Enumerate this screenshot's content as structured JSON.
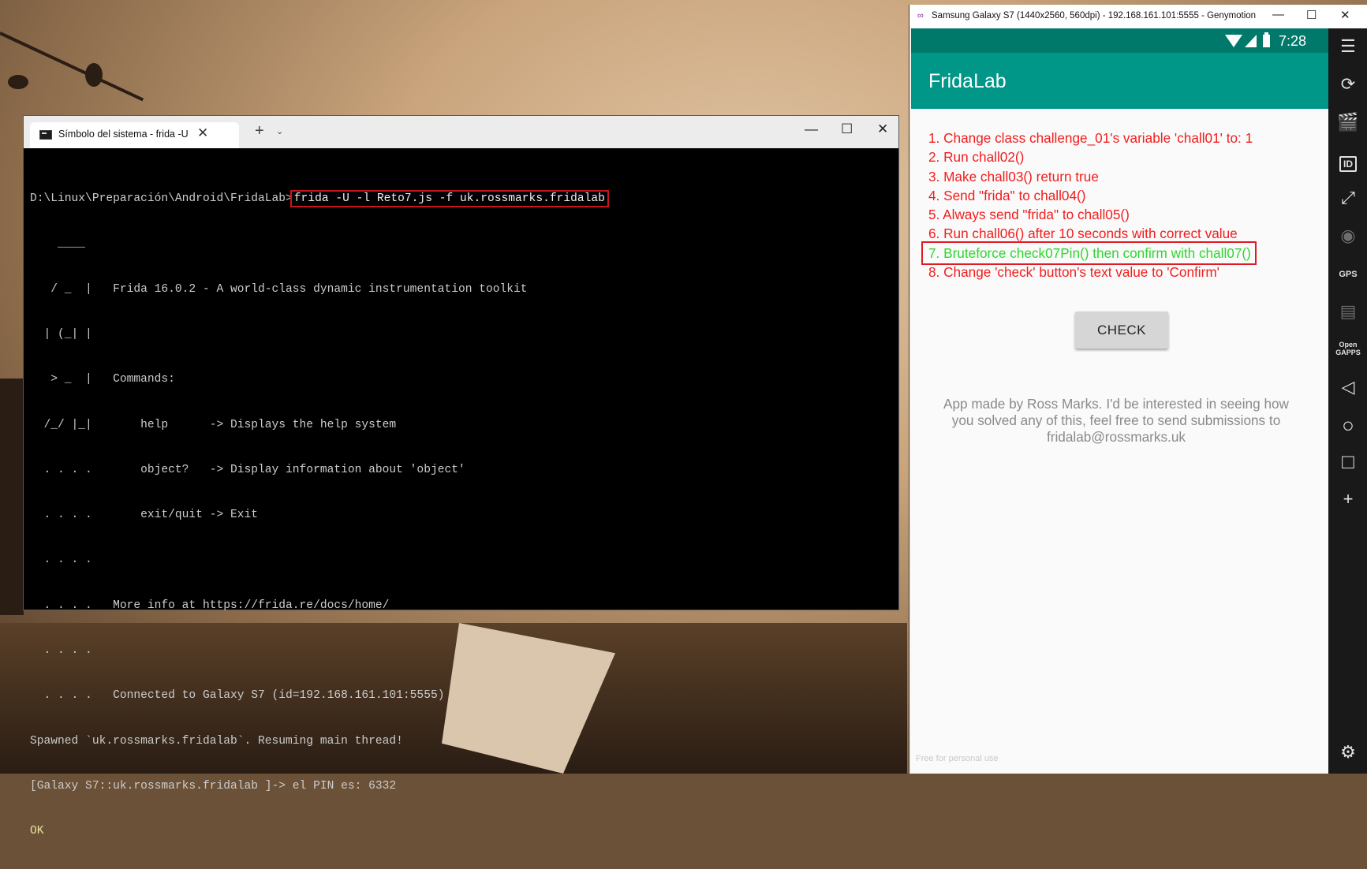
{
  "terminal": {
    "tab_title": "Símbolo del sistema - frida  -U",
    "tab_close": "✕",
    "new_tab": "+",
    "dropdown": "⌄",
    "minimize": "—",
    "maximize": "☐",
    "close": "✕",
    "prompt": "D:\\Linux\\Preparación\\Android\\FridaLab>",
    "command": "frida -U -l Reto7.js -f uk.rossmarks.fridalab",
    "banner_lines": [
      "    ____",
      "   / _  |   Frida 16.0.2 - A world-class dynamic instrumentation toolkit",
      "  | (_| |",
      "   > _  |   Commands:",
      "  /_/ |_|       help      -> Displays the help system",
      "  . . . .       object?   -> Display information about 'object'",
      "  . . . .       exit/quit -> Exit",
      "  . . . .",
      "  . . . .   More info at https://frida.re/docs/home/",
      "  . . . .",
      "  . . . .   Connected to Galaxy S7 (id=192.168.161.101:5555)"
    ],
    "spawn_line": "Spawned `uk.rossmarks.fridalab`. Resuming main thread!",
    "pin_line": "[Galaxy S7::uk.rossmarks.fridalab ]-> el PIN es: 6332",
    "ok_line": "OK"
  },
  "emulator": {
    "window_title": "Samsung Galaxy S7 (1440x2560, 560dpi) - 192.168.161.101:5555 - Genymotion",
    "title_icon": "∞",
    "minimize": "—",
    "maximize": "☐",
    "close": "✕",
    "status_time": "7:28",
    "app_title": "FridaLab",
    "challenges": [
      {
        "label": "1. Change class challenge_01's variable 'chall01' to: 1",
        "completed": false
      },
      {
        "label": "2. Run chall02()",
        "completed": false
      },
      {
        "label": "3. Make chall03() return true",
        "completed": false
      },
      {
        "label": "4. Send \"frida\" to chall04()",
        "completed": false
      },
      {
        "label": "5. Always send \"frida\" to chall05()",
        "completed": false
      },
      {
        "label": "6. Run chall06() after 10 seconds with correct value",
        "completed": false
      },
      {
        "label": "7. Bruteforce check07Pin() then confirm with chall07()",
        "completed": true
      },
      {
        "label": "8. Change 'check' button's text value to 'Confirm'",
        "completed": false
      }
    ],
    "check_button": "CHECK",
    "credits": "App made by Ross Marks. I'd be interested in seeing how you solved any of this, feel free to send submissions to fridalab@rossmarks.uk",
    "watermark": "Free for personal use",
    "sidebar": {
      "menu": "☰",
      "rotate": "⟳",
      "camera": "🎬",
      "id": "ID",
      "fullscreen": "⤢",
      "rss": "◉",
      "gps": "GPS",
      "media": "▤",
      "open_gapps": "Open GAPPS",
      "back": "◁",
      "home": "○",
      "recents": "□",
      "add": "+",
      "settings": "⚙"
    }
  },
  "colors": {
    "challenge_pending": "#f21d1d",
    "challenge_done": "#2fd62f",
    "appbar": "#009688",
    "statusbar": "#00796b",
    "highlight_box": "#e01b24"
  }
}
